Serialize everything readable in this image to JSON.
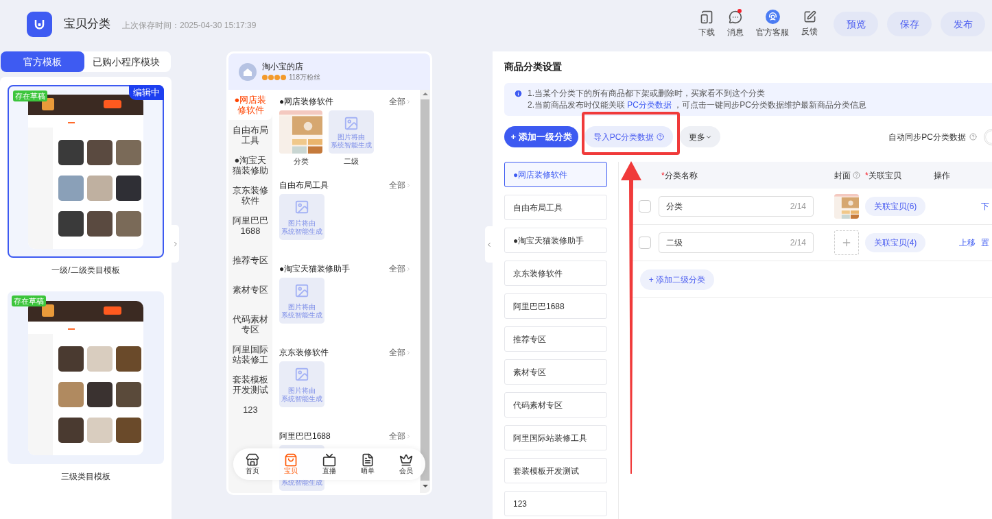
{
  "header": {
    "title": "宝贝分类",
    "saved_time": "上次保存时间：2025-04-30 15:17:39",
    "actions": [
      {
        "kind": "download",
        "label": "下载",
        "notification": false
      },
      {
        "kind": "message",
        "label": "消息",
        "notification": true
      },
      {
        "kind": "service",
        "label": "官方客服",
        "notification": false
      },
      {
        "kind": "feedback",
        "label": "反馈",
        "notification": false
      }
    ],
    "buttons": [
      "预览",
      "保存",
      "发布"
    ]
  },
  "template_panel": {
    "tabs": [
      {
        "label": "官方模板",
        "selected": true
      },
      {
        "label": "已购小程序模块",
        "selected": false
      }
    ],
    "templates": [
      {
        "name": "一级/二级类目模板",
        "selected": true,
        "draft_badge": "存在草稿",
        "editing_badge": "编辑中"
      },
      {
        "name": "三级类目模板",
        "selected": false,
        "draft_badge": "存在草稿"
      }
    ]
  },
  "phone_preview": {
    "store_name": "淘小宝的店",
    "stars": 4,
    "followers": "118万粉丝",
    "nav": [
      {
        "label": "●网店装修软件",
        "selected": true
      },
      {
        "label": "自由布局工具",
        "selected": false
      },
      {
        "label": "●淘宝天猫装修助",
        "selected": false
      },
      {
        "label": "京东装修软件",
        "selected": false
      },
      {
        "label": "阿里巴巴1688",
        "selected": false
      },
      {
        "label": "推荐专区",
        "selected": false
      },
      {
        "label": "素材专区",
        "selected": false
      },
      {
        "label": "代码素材专区",
        "selected": false
      },
      {
        "label": "阿里国际站装修工",
        "selected": false
      },
      {
        "label": "套装模板开发测试",
        "selected": false
      },
      {
        "label": "123",
        "selected": false
      }
    ],
    "sections": [
      {
        "title": "●网店装修软件",
        "more": "全部",
        "tiles": [
          {
            "kind": "picture",
            "label": "分类"
          },
          {
            "kind": "placeholder",
            "lines": [
              "图片将由",
              "系统智能生成"
            ],
            "label": "二级"
          }
        ]
      },
      {
        "title": "自由布局工具",
        "more": "全部",
        "tiles": [
          {
            "kind": "placeholder",
            "lines": [
              "图片将由",
              "系统智能生成"
            ]
          }
        ]
      },
      {
        "title": "●淘宝天猫装修助手",
        "more": "全部",
        "tiles": [
          {
            "kind": "placeholder",
            "lines": [
              "图片将由",
              "系统智能生成"
            ]
          }
        ]
      },
      {
        "title": "京东装修软件",
        "more": "全部",
        "tiles": [
          {
            "kind": "placeholder",
            "lines": [
              "图片将由",
              "系统智能生成"
            ]
          }
        ]
      },
      {
        "title": "阿里巴巴1688",
        "more": "全部",
        "tiles": [
          {
            "kind": "placeholder",
            "lines": [
              "系统智能生成"
            ]
          }
        ]
      }
    ],
    "tab_bar": [
      {
        "kind": "home",
        "label": "首页",
        "selected": false
      },
      {
        "kind": "bag",
        "label": "宝贝",
        "selected": true
      },
      {
        "kind": "live",
        "label": "直播",
        "selected": false
      },
      {
        "kind": "order",
        "label": "晒单",
        "selected": false
      },
      {
        "kind": "member",
        "label": "会员",
        "selected": false
      }
    ]
  },
  "settings": {
    "title": "商品分类设置",
    "notice": {
      "line_1": "1.当某个分类下的所有商品都下架或删除时，买家看不到这个分类",
      "line_2_before": "2.当前商品发布时仅能关联 ",
      "line_2_link": "PC分类数据",
      "line_2_after": " ，可点击一键同步PC分类数据维护最新商品分类信息"
    },
    "toolbar": {
      "add_button": "+ 添加一级分类",
      "import_button": "导入PC分类数据",
      "more_button": "更多",
      "sync_label": "自动同步PC分类数据",
      "sync_on": false
    },
    "categories": [
      {
        "label": "●网店装修软件",
        "selected": true
      },
      {
        "label": "自由布局工具",
        "selected": false
      },
      {
        "label": "●淘宝天猫装修助手",
        "selected": false
      },
      {
        "label": "京东装修软件",
        "selected": false
      },
      {
        "label": "阿里巴巴1688",
        "selected": false
      },
      {
        "label": "推荐专区",
        "selected": false
      },
      {
        "label": "素材专区",
        "selected": false
      },
      {
        "label": "代码素材专区",
        "selected": false
      },
      {
        "label": "阿里国际站装修工具",
        "selected": false
      },
      {
        "label": "套装模板开发测试",
        "selected": false
      },
      {
        "label": "123",
        "selected": false
      }
    ],
    "table": {
      "columns": [
        {
          "label": "分类名称",
          "mark": "*",
          "help": false
        },
        {
          "label": "封面",
          "help": true
        },
        {
          "label": "关联宝贝",
          "mark": "*",
          "help": false
        },
        {
          "label": "操作",
          "help": false
        }
      ],
      "rows": [
        {
          "checked": false,
          "name": "分类",
          "count": "2/14",
          "cover": {
            "kind": "picture"
          },
          "link": "关联宝贝(6)",
          "actions": [
            "下"
          ]
        },
        {
          "checked": false,
          "name": "二级",
          "count": "2/14",
          "cover": {
            "kind": "empty"
          },
          "link": "关联宝贝(4)",
          "actions": [
            "上移",
            "置"
          ]
        }
      ]
    },
    "add_sub_button": "+ 添加二级分类"
  }
}
